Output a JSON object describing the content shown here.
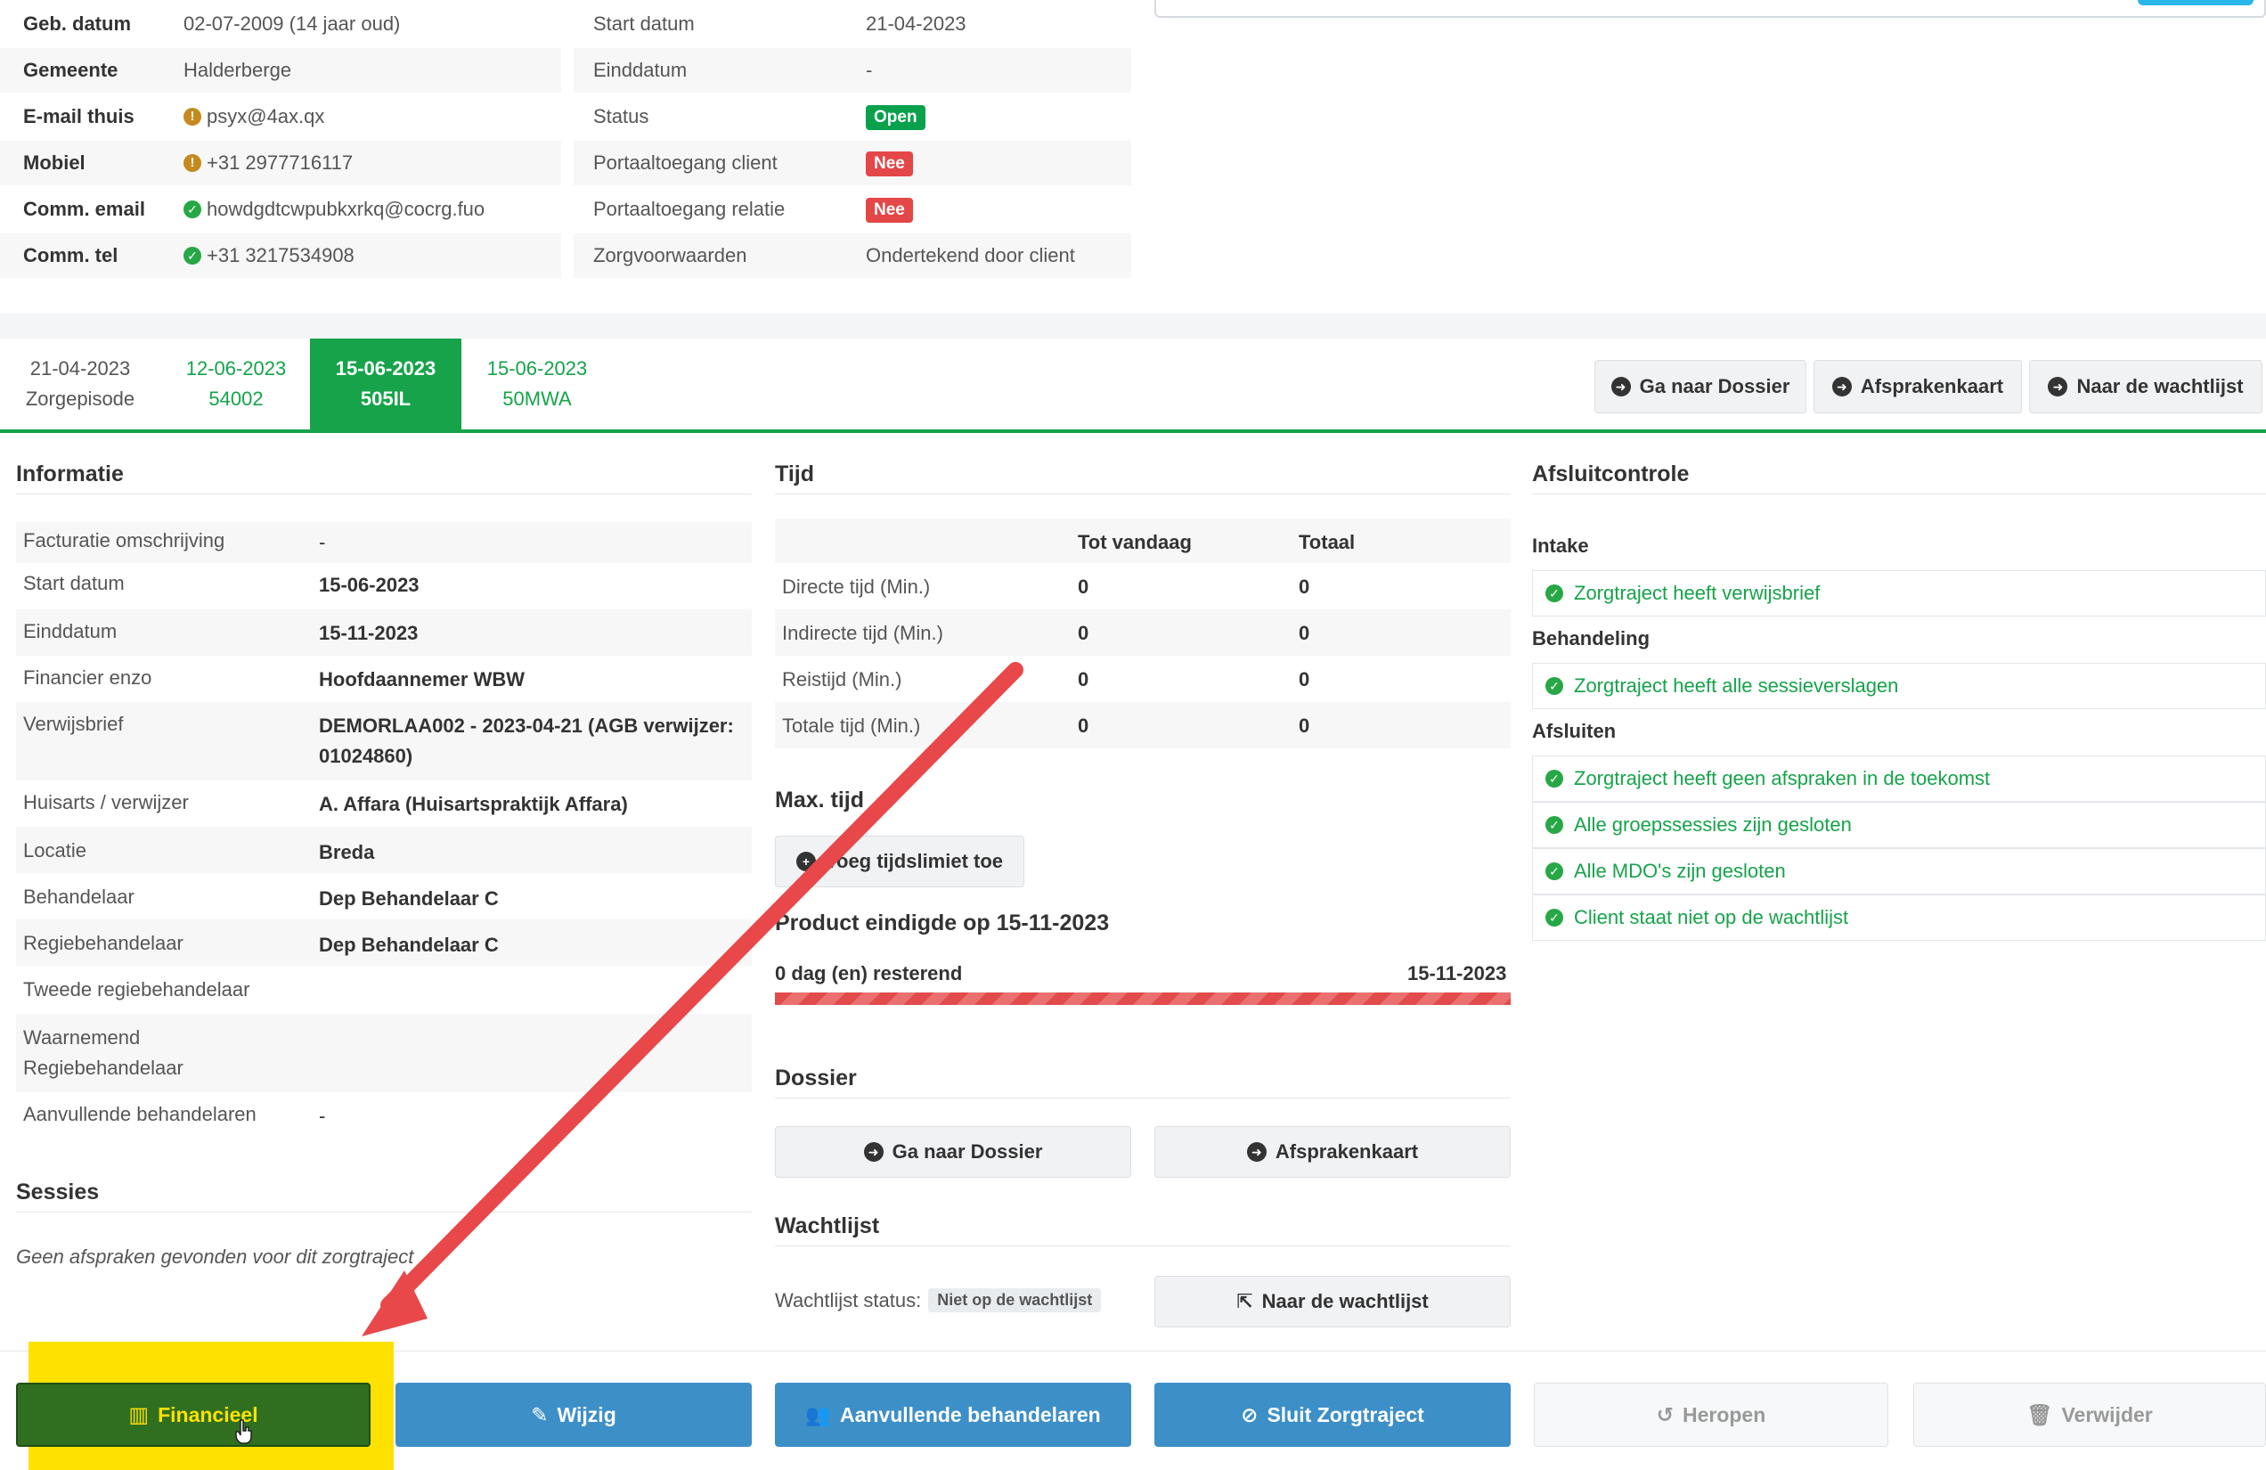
{
  "client": {
    "left_rows": [
      {
        "label": "Geb. datum",
        "value": "02-07-2009 (14 jaar oud)",
        "icon": ""
      },
      {
        "label": "Gemeente",
        "value": "Halderberge",
        "icon": ""
      },
      {
        "label": "E-mail thuis",
        "value": "psyx@4ax.qx",
        "icon": "warning-icon"
      },
      {
        "label": "Mobiel",
        "value": "+31 2977716117",
        "icon": "warning-icon"
      },
      {
        "label": "Comm. email",
        "value": "howdgdtcwpubkxrkq@cocrg.fuo",
        "icon": "check-icon"
      },
      {
        "label": "Comm. tel",
        "value": "+31 3217534908",
        "icon": "check-icon"
      }
    ],
    "right_rows": [
      {
        "label": "Start datum",
        "value": "21-04-2023"
      },
      {
        "label": "Einddatum",
        "value": "-"
      },
      {
        "label": "Status",
        "badge": "Open",
        "badge_color": "#0aa14c"
      },
      {
        "label": "Portaaltoegang client",
        "badge": "Nee",
        "badge_color": "#e34747"
      },
      {
        "label": "Portaaltoegang relatie",
        "badge": "Nee",
        "badge_color": "#e34747"
      },
      {
        "label": "Zorgvoorwaarden",
        "value": "Ondertekend door client"
      }
    ]
  },
  "tabs": [
    {
      "line1": "21-04-2023",
      "line2": "Zorgepisode",
      "state": "muted"
    },
    {
      "line1": "12-06-2023",
      "line2": "54002",
      "state": "green"
    },
    {
      "line1": "15-06-2023",
      "line2": "505IL",
      "state": "active"
    },
    {
      "line1": "15-06-2023",
      "line2": "50MWA",
      "state": "green"
    }
  ],
  "header_buttons": [
    "Ga naar Dossier",
    "Afsprakenkaart",
    "Naar de wachtlijst"
  ],
  "informatie": {
    "title": "Informatie",
    "rows": [
      {
        "label": "Facturatie omschrijving",
        "value": "-"
      },
      {
        "label": "Start datum",
        "value": "15-06-2023"
      },
      {
        "label": "Einddatum",
        "value": "15-11-2023"
      },
      {
        "label": "Financier enzo",
        "value": "Hoofdaannemer WBW"
      },
      {
        "label": "Verwijsbrief",
        "value": "DEMORLAA002 - 2023-04-21 (AGB verwijzer: 01024860)"
      },
      {
        "label": "Huisarts / verwijzer",
        "value": "A. Affara (Huisartspraktijk Affara)"
      },
      {
        "label": "Locatie",
        "value": "Breda"
      },
      {
        "label": "Behandelaar",
        "value": "Dep Behandelaar C"
      },
      {
        "label": "Regiebehandelaar",
        "value": "Dep Behandelaar C"
      },
      {
        "label": "Tweede regiebehandelaar",
        "value": ""
      },
      {
        "label": "Waarnemend Regiebehandelaar",
        "value": ""
      },
      {
        "label": "Aanvullende behandelaren",
        "value": "-"
      }
    ]
  },
  "sessies": {
    "title": "Sessies",
    "empty_text": "Geen afspraken gevonden voor dit zorgtraject"
  },
  "tijd": {
    "title": "Tijd",
    "col_tot": "Tot vandaag",
    "col_totaal": "Totaal",
    "rows": [
      {
        "label": "Directe tijd (Min.)",
        "tot": "0",
        "totaal": "0"
      },
      {
        "label": "Indirecte tijd (Min.)",
        "tot": "0",
        "totaal": "0"
      },
      {
        "label": "Reistijd (Min.)",
        "tot": "0",
        "totaal": "0"
      },
      {
        "label": "Totale tijd (Min.)",
        "tot": "0",
        "totaal": "0"
      }
    ],
    "max_title": "Max. tijd",
    "max_button": "Voeg tijdslimiet toe",
    "product_title": "Product eindigde op 15-11-2023",
    "remaining": "0 dag (en) resterend",
    "end_date": "15-11-2023",
    "progress_pct": 100
  },
  "dossier": {
    "title": "Dossier",
    "btn_dossier": "Ga naar Dossier",
    "btn_afspraken": "Afsprakenkaart"
  },
  "wachtlijst": {
    "title": "Wachtlijst",
    "status_label": "Wachtlijst status:",
    "status_value": "Niet op de wachtlijst",
    "button": "Naar de wachtlijst"
  },
  "afsluit": {
    "title": "Afsluitcontrole",
    "groups": [
      {
        "name": "Intake",
        "items": [
          "Zorgtraject heeft verwijsbrief"
        ]
      },
      {
        "name": "Behandeling",
        "items": [
          "Zorgtraject heeft alle sessieverslagen"
        ]
      },
      {
        "name": "Afsluiten",
        "items": [
          "Zorgtraject heeft geen afspraken in de toekomst",
          "Alle groepssessies zijn gesloten",
          "Alle MDO's zijn gesloten",
          "Client staat niet op de wachtlijst"
        ]
      }
    ]
  },
  "actions": {
    "financieel": "Financieel",
    "wijzig": "Wijzig",
    "aanvullende": "Aanvullende behandelaren",
    "sluit": "Sluit Zorgtraject",
    "heropen": "Heropen",
    "verwijder": "Verwijder"
  },
  "colors": {
    "accent_green": "#16a34a",
    "action_blue": "#3d8fc8",
    "highlight_yellow": "#ffe100",
    "arrow_red": "#e8484a"
  }
}
